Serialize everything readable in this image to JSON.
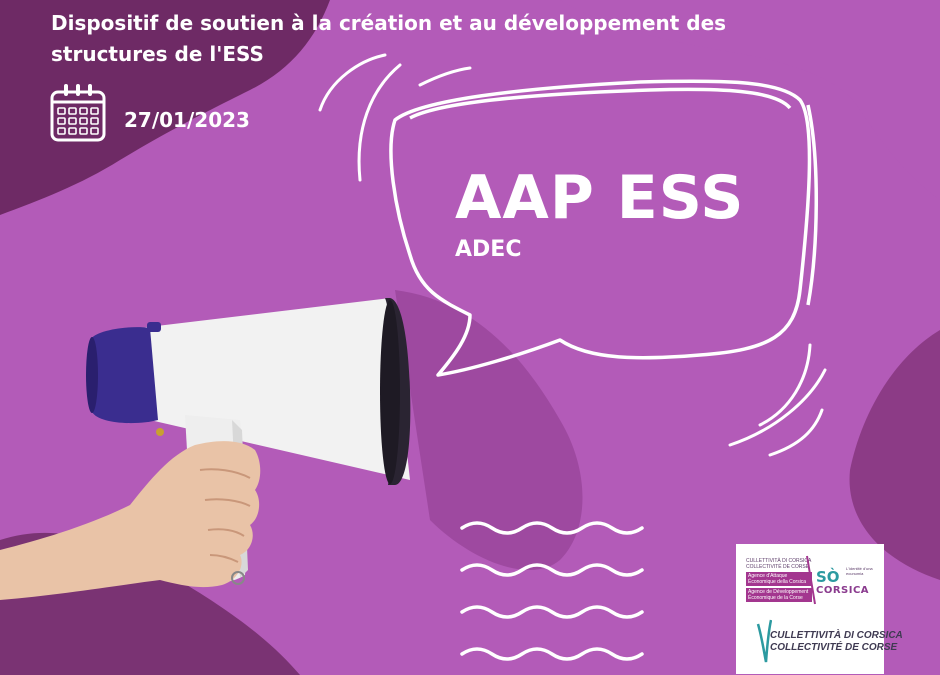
{
  "header": {
    "title": "Dispositif de soutien à la création et au développement des structures de l'ESS",
    "date": "27/01/2023",
    "date_icon": "calendar-icon"
  },
  "bubble": {
    "headline": "AAP ESS",
    "subline": "ADEC"
  },
  "logos": {
    "top_left_line1": "CULLETTIVITÀ DI CORSICA",
    "top_left_line2": "COLLECTIVITÉ DE CORSE",
    "top_left_band1": "Agence d'Attaque Économique della Corsica",
    "top_left_band2": "Agence de Développement Économique de la Corse",
    "so_corsica_mark": "SÒ",
    "so_corsica_name": "CORSICA",
    "so_corsica_tagline": "L'identité d'una ecunumia",
    "cdc_line1": "CULLETTIVITÀ DI CORSICA",
    "cdc_line2": "COLLECTIVITÉ DE CORSE"
  },
  "colors": {
    "background": "#b35bb8",
    "dark_blob": "#6e2a65",
    "bubble_stroke": "#ffffff",
    "megaphone_body": "#f2f2f2",
    "megaphone_cap": "#3a2d8f"
  },
  "icons": [
    "calendar-icon",
    "speech-bubble-icon",
    "megaphone-icon",
    "wave-lines-icon"
  ]
}
